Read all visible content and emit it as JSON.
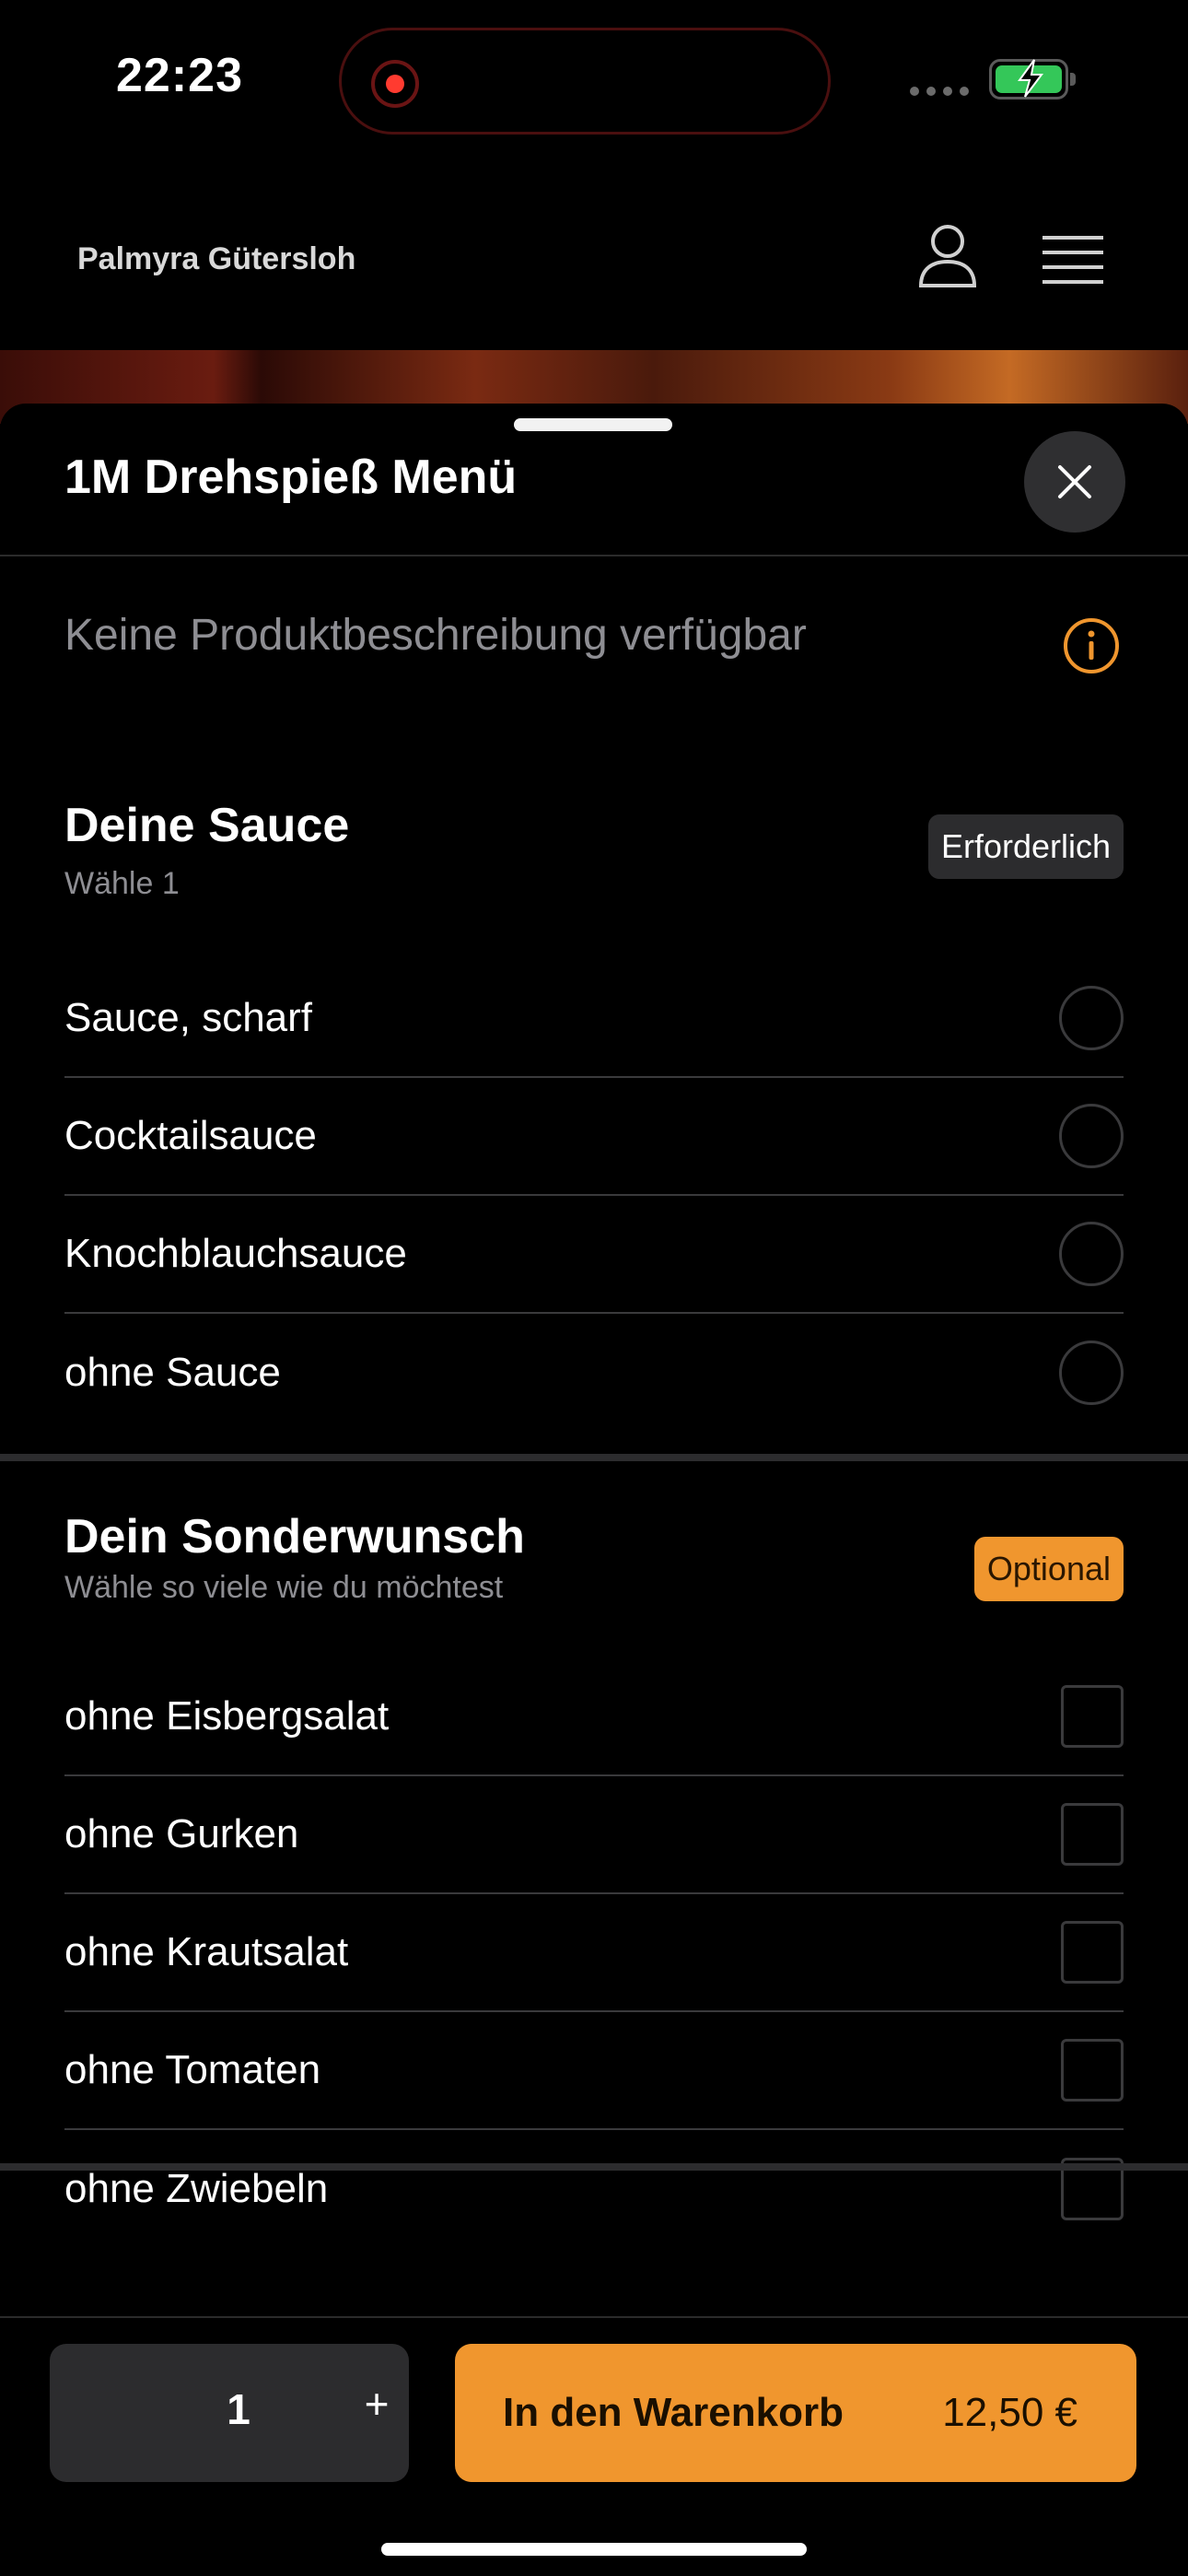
{
  "status_bar": {
    "time": "22:23",
    "battery_charging": true
  },
  "header": {
    "brand": "Palmyra Gütersloh",
    "account_icon": "person-icon",
    "menu_icon": "hamburger-menu-icon"
  },
  "sheet": {
    "title": "1M Drehspieß Menü",
    "description": "Keine Produktbeschreibung verfügbar"
  },
  "groups": [
    {
      "title": "Deine Sauce",
      "subtitle": "Wähle 1",
      "badge": "Erforderlich",
      "type": "radio",
      "options": [
        "Sauce, scharf",
        "Cocktailsauce",
        "Knochblauchsauce",
        "ohne Sauce"
      ]
    },
    {
      "title": "Dein Sonderwunsch",
      "subtitle": "Wähle so viele wie du möchtest",
      "badge": "Optional",
      "type": "checkbox",
      "options": [
        "ohne Eisbergsalat",
        "ohne Gurken",
        "ohne Krautsalat",
        "ohne Tomaten",
        "ohne Zwiebeln"
      ]
    }
  ],
  "footer": {
    "quantity": "1",
    "plus": "+",
    "cart_label": "In den Warenkorb",
    "price": "12,50 €"
  },
  "colors": {
    "accent": "#f0962e",
    "background": "#000000",
    "surface": "#2c2c2e"
  }
}
